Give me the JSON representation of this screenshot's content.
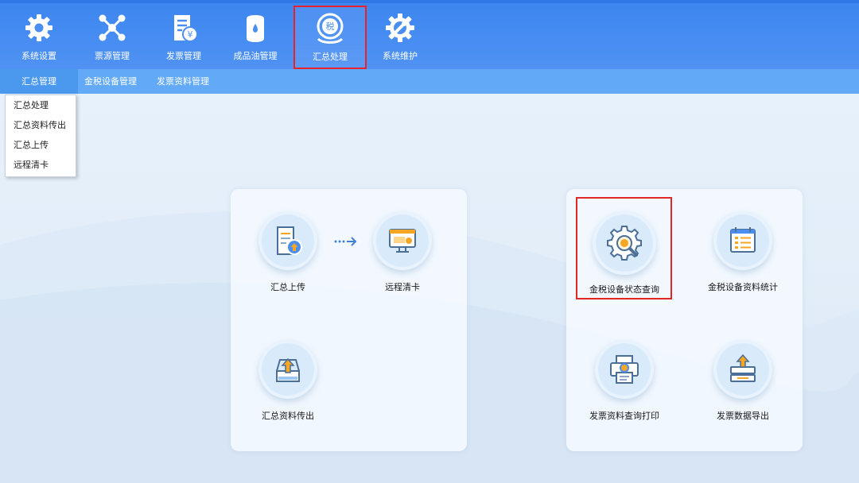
{
  "toolbar": {
    "items": [
      {
        "label": "系统设置",
        "icon": "gear-icon"
      },
      {
        "label": "票源管理",
        "icon": "network-icon"
      },
      {
        "label": "发票管理",
        "icon": "invoice-icon"
      },
      {
        "label": "成品油管理",
        "icon": "oil-drum-icon"
      },
      {
        "label": "汇总处理",
        "icon": "tax-summary-icon"
      },
      {
        "label": "系统维护",
        "icon": "maintenance-icon"
      }
    ],
    "active": "汇总处理"
  },
  "subbar": {
    "items": [
      {
        "label": "汇总管理"
      },
      {
        "label": "金税设备管理"
      },
      {
        "label": "发票资料管理"
      }
    ]
  },
  "dropdown": {
    "items": [
      {
        "label": "汇总处理"
      },
      {
        "label": "汇总资料传出"
      },
      {
        "label": "汇总上传"
      },
      {
        "label": "远程清卡"
      }
    ]
  },
  "left_panel": {
    "upload": {
      "label": "汇总上传",
      "icon": "upload-document-icon"
    },
    "clear": {
      "label": "远程清卡",
      "icon": "monitor-icon"
    },
    "export": {
      "label": "汇总资料传出",
      "icon": "tray-upload-icon"
    },
    "arrow_icon": "dotted-arrow-right-icon"
  },
  "right_panel": {
    "status": {
      "label": "金税设备状态查询",
      "icon": "gear-search-icon"
    },
    "stats": {
      "label": "金税设备资料统计",
      "icon": "calendar-list-icon"
    },
    "print": {
      "label": "发票资料查询打印",
      "icon": "printer-search-icon"
    },
    "export": {
      "label": "发票数据导出",
      "icon": "data-export-icon"
    }
  },
  "colors": {
    "toolbar": "#4a8ef2",
    "subbar": "#62aaf7",
    "highlight": "#e02626",
    "icon_accent": "#f5a623"
  }
}
